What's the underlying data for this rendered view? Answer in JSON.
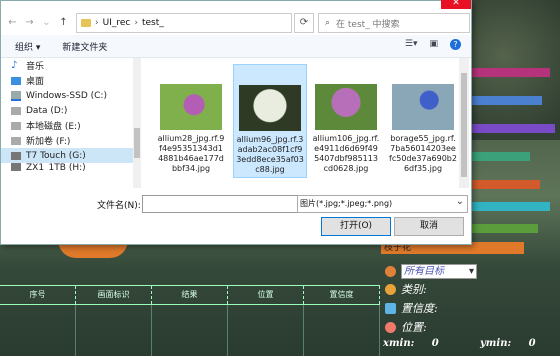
{
  "dialog": {
    "nav": {
      "back": "←",
      "forward": "→",
      "up": "↑"
    },
    "breadcrumb": [
      "UI_rec",
      "test_"
    ],
    "breadcrumb_sep": "›",
    "search_placeholder": "在 test_ 中搜索",
    "toolbar": {
      "organize": "组织 ▾",
      "new_folder": "新建文件夹"
    },
    "sidebar": [
      {
        "label": "音乐",
        "icon": "music-icon"
      },
      {
        "label": "桌面",
        "icon": "desktop-icon"
      },
      {
        "label": "Windows-SSD (C:)",
        "icon": "drive-icon"
      },
      {
        "label": "Data (D:)",
        "icon": "drive-icon"
      },
      {
        "label": "本地磁盘 (E:)",
        "icon": "drive-icon"
      },
      {
        "label": "新加卷 (F:)",
        "icon": "drive-icon"
      },
      {
        "label": "T7 Touch (G:)",
        "icon": "usb-drive-icon",
        "selected": true
      },
      {
        "label": "ZX1_1TB (H:)",
        "icon": "usb-drive-icon"
      }
    ],
    "files": [
      {
        "name": "allium28_jpg.rf.9f4e95351343d14881b46ae177dbbf34.jpg",
        "colors": [
          "#7fb04c",
          "#b35db5"
        ],
        "selected": false
      },
      {
        "name": "allium96_jpg.rf.3adab2ac08f1cf93edd8ece35af03c88.jpg",
        "colors": [
          "#2f3a24",
          "#e9ede0"
        ],
        "selected": true
      },
      {
        "name": "allium106_jpg.rf.e4911d6d69f495407dbf985113cd0628.jpg",
        "colors": [
          "#5d8a3a",
          "#b86fb9"
        ],
        "selected": false
      },
      {
        "name": "borage55_jpg.rf.7ba56014203eefc50de37a690b26df35.jpg",
        "colors": [
          "#8aa7b8",
          "#3f60c8"
        ],
        "selected": false
      }
    ],
    "filename_label": "文件名(N):",
    "filename_value": "",
    "filter": "图片(*.jpg;*.jpeg;*.png)",
    "open": "打开(O)",
    "cancel": "取消"
  },
  "app": {
    "table_headers": [
      "序号",
      "画面标识",
      "结果",
      "位置",
      "置信度"
    ],
    "panel_title": "枝子花",
    "target_select": "所有目标",
    "labels": {
      "category": "类别:",
      "confidence": "置信度:",
      "position": "位置:"
    },
    "xmin_label": "xmin:",
    "xmin_value": "0",
    "ymin_label": "ymin:",
    "ymin_value": "0",
    "accent": "#e07a2a"
  }
}
